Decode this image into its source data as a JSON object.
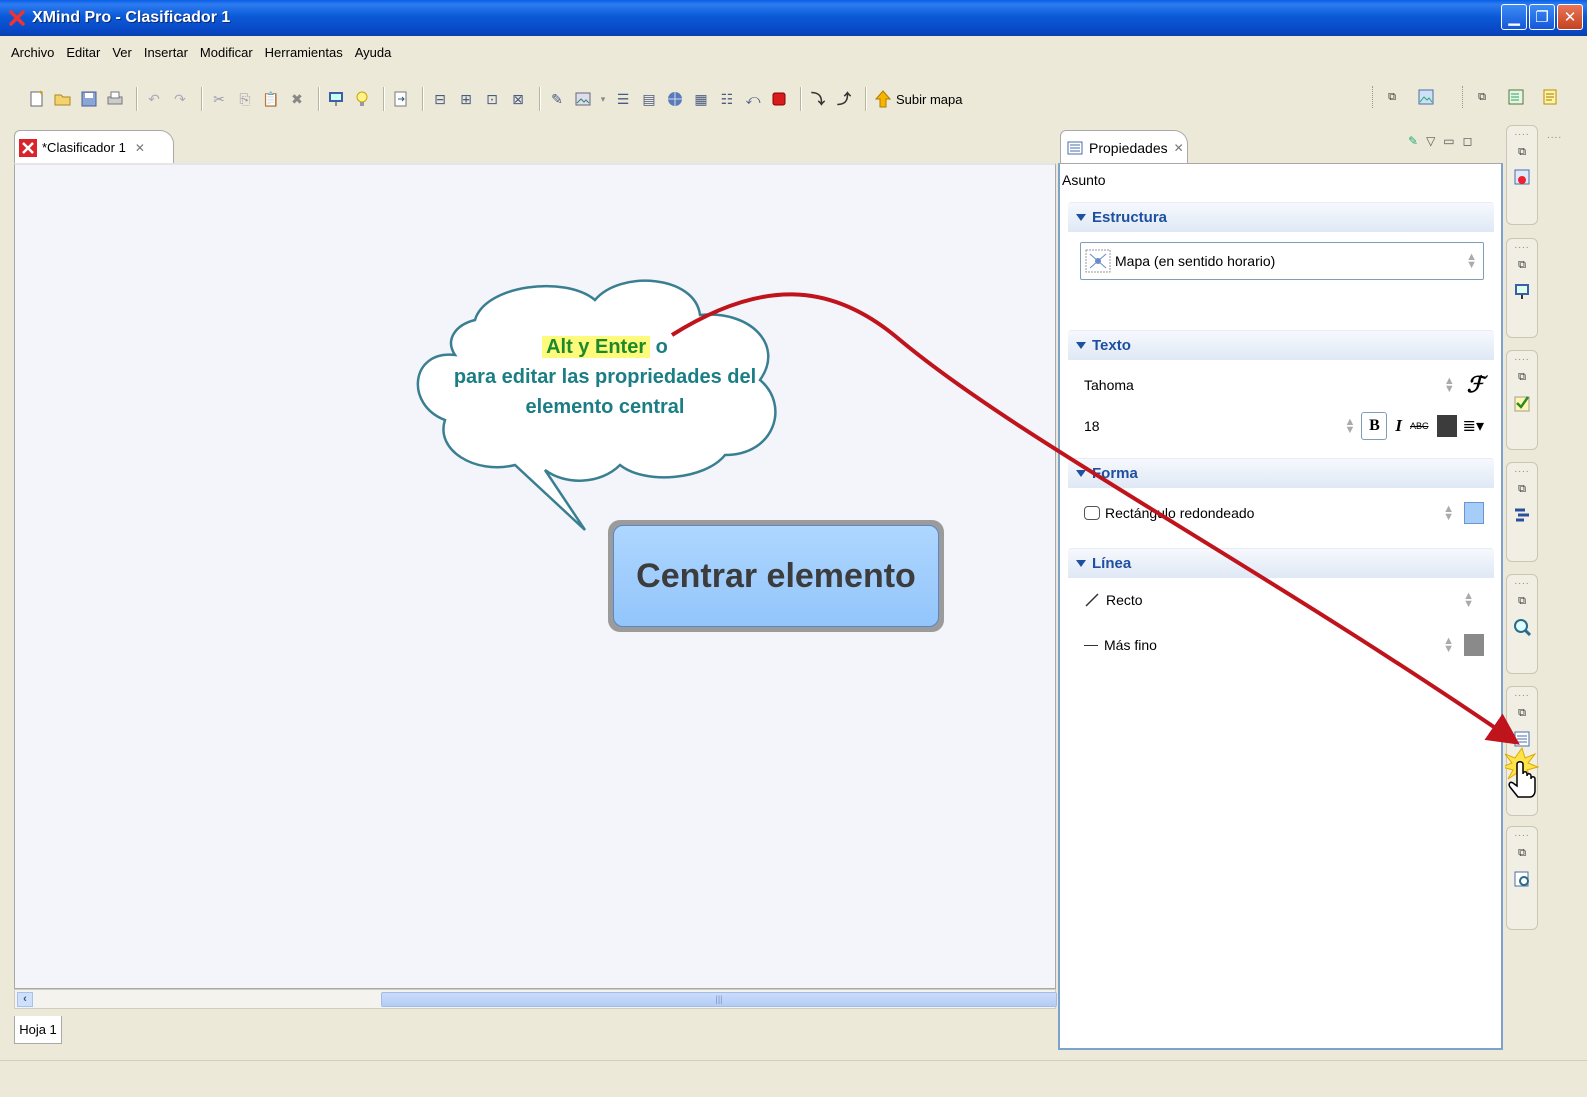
{
  "window": {
    "title": "XMind Pro - Clasificador 1"
  },
  "menu": [
    "Archivo",
    "Editar",
    "Ver",
    "Insertar",
    "Modificar",
    "Herramientas",
    "Ayuda"
  ],
  "toolbar": {
    "subir_label": "Subir mapa"
  },
  "editor": {
    "tab_label": "*Clasificador 1",
    "sheet_tab": "Hoja 1"
  },
  "mindmap": {
    "central_topic": "Centrar elemento",
    "callout": {
      "highlight": "Alt y Enter",
      "after_highlight": " o",
      "line2": "para editar las propriedades del",
      "line3": "elemento central"
    }
  },
  "properties": {
    "tab_label": "Propiedades",
    "subject": "Asunto",
    "sections": {
      "estructura": {
        "title": "Estructura",
        "value": "Mapa (en sentido horario)"
      },
      "texto": {
        "title": "Texto",
        "font": "Tahoma",
        "size": "18",
        "bold": "B",
        "italic": "I",
        "strike": "ABC"
      },
      "forma": {
        "title": "Forma",
        "shape": "Rectángulo redondeado"
      },
      "linea": {
        "title": "Línea",
        "style": "Recto",
        "weight": "Más fino"
      }
    }
  },
  "colors": {
    "titlebar": "#0a5fe6",
    "central_fill": "#9bcbfc",
    "callout_text": "#1c7e85",
    "arrow": "#c0141c",
    "highlight": "#fefb7c",
    "section_text": "#1e4fa0"
  }
}
